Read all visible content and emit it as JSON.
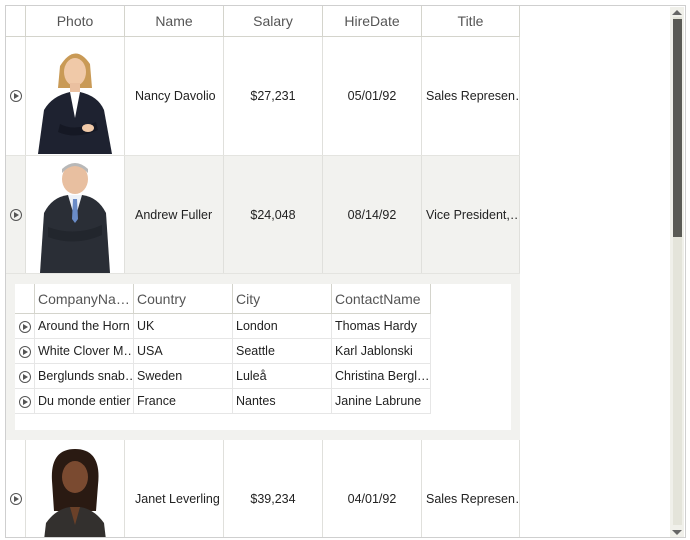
{
  "grid": {
    "columns": [
      "Photo",
      "Name",
      "Salary",
      "HireDate",
      "Title"
    ],
    "rows": [
      {
        "name": "Nancy Davolio",
        "salary": "$27,231",
        "hire_date": "05/01/92",
        "title": "Sales Represen…"
      },
      {
        "name": "Andrew Fuller",
        "salary": "$24,048",
        "hire_date": "08/14/92",
        "title": "Vice President,…"
      },
      {
        "name": "Janet Leverling",
        "salary": "$39,234",
        "hire_date": "04/01/92",
        "title": "Sales Represen…"
      }
    ]
  },
  "detail": {
    "columns": [
      "CompanyNa…",
      "Country",
      "City",
      "ContactName"
    ],
    "rows": [
      {
        "company": "Around the Horn",
        "country": "UK",
        "city": "London",
        "contact": "Thomas Hardy"
      },
      {
        "company": "White Clover M…",
        "country": "USA",
        "city": "Seattle",
        "contact": "Karl Jablonski"
      },
      {
        "company": "Berglunds snab…",
        "country": "Sweden",
        "city": "Luleå",
        "contact": "Christina Bergl…"
      },
      {
        "company": "Du monde entier",
        "country": "France",
        "city": "Nantes",
        "contact": "Janine Labrune"
      }
    ]
  },
  "colors": {
    "alt_row": "#f2f2ef",
    "border": "#d4d4cc",
    "scroll_thumb": "#5a5a55"
  },
  "scrollbar": {
    "position": 0.0,
    "visible_fraction": 0.43
  }
}
